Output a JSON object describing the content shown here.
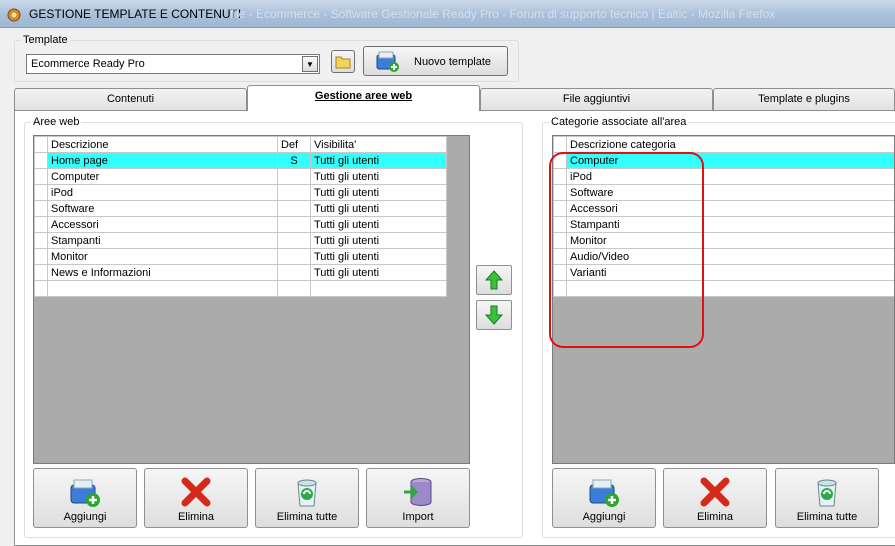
{
  "window": {
    "title": "GESTIONE TEMPLATE E CONTENUTI",
    "background_title": "file - Ecommerce - Software Gestionale Ready Pro - Forum di supporto tecnico | Ealtic - Mozilla Firefox"
  },
  "template_group": {
    "legend": "Template",
    "selected": "Ecommerce Ready Pro",
    "new_template_label": "Nuovo template"
  },
  "tabs": [
    {
      "label": "Contenuti"
    },
    {
      "label": "Gestione aree web"
    },
    {
      "label": "File aggiuntivi"
    },
    {
      "label": "Template e plugins"
    }
  ],
  "aree_web": {
    "legend": "Aree web",
    "columns": [
      "Descrizione",
      "Def",
      "Visibilita'"
    ],
    "rows": [
      {
        "descrizione": "Home page",
        "def": "S",
        "visibilita": "Tutti gli utenti"
      },
      {
        "descrizione": "Computer",
        "def": "",
        "visibilita": "Tutti gli utenti"
      },
      {
        "descrizione": "iPod",
        "def": "",
        "visibilita": "Tutti gli utenti"
      },
      {
        "descrizione": "Software",
        "def": "",
        "visibilita": "Tutti gli utenti"
      },
      {
        "descrizione": "Accessori",
        "def": "",
        "visibilita": "Tutti gli utenti"
      },
      {
        "descrizione": "Stampanti",
        "def": "",
        "visibilita": "Tutti gli utenti"
      },
      {
        "descrizione": "Monitor",
        "def": "",
        "visibilita": "Tutti gli utenti"
      },
      {
        "descrizione": "News e Informazioni",
        "def": "",
        "visibilita": "Tutti gli utenti"
      }
    ],
    "buttons": {
      "aggiungi": "Aggiungi",
      "elimina": "Elimina",
      "elimina_tutte": "Elimina tutte",
      "import": "Import"
    }
  },
  "categorie": {
    "legend": "Categorie associate all'area",
    "columns": [
      "Descrizione categoria"
    ],
    "rows": [
      "Computer",
      "iPod",
      "Software",
      "Accessori",
      "Stampanti",
      "Monitor",
      "Audio/Video",
      "Varianti"
    ],
    "buttons": {
      "aggiungi": "Aggiungi",
      "elimina": "Elimina",
      "elimina_tutte": "Elimina tutte"
    }
  },
  "colors": {
    "selected_row": "#33ffff",
    "highlight_circle": "#e01010",
    "grid_empty": "#ababab"
  },
  "icons": {
    "move_up": "green-up-arrow-icon",
    "move_down": "green-down-arrow-icon",
    "add": "add-plus-icon",
    "delete": "red-x-icon",
    "delete_all": "trash-bin-icon",
    "import": "database-import-icon",
    "folder": "folder-icon"
  }
}
